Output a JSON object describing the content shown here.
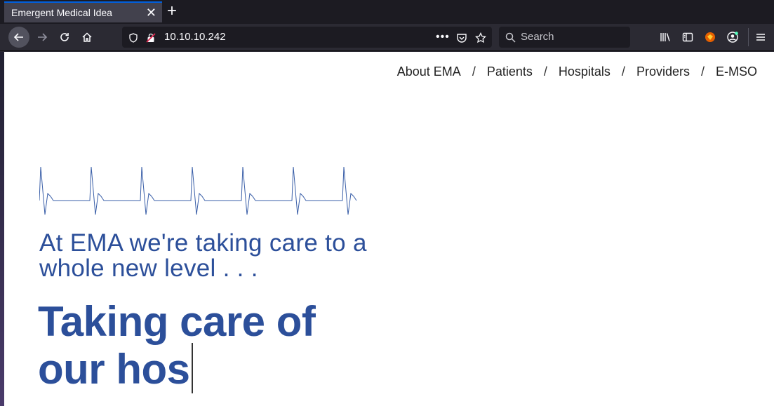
{
  "browser": {
    "tab_title": "Emergent Medical Idea",
    "tab_close": "✕",
    "new_tab": "+",
    "url": "10.10.10.242",
    "search_placeholder": "Search"
  },
  "nav": {
    "items": [
      {
        "label": "About EMA"
      },
      {
        "label": "Patients"
      },
      {
        "label": "Hospitals"
      },
      {
        "label": "Providers"
      },
      {
        "label": "E-MSO"
      }
    ],
    "separator": "/"
  },
  "hero": {
    "tagline": "At EMA we're taking care to a whole new level . . .",
    "headline_line1": "Taking care of",
    "headline_line2": "our hos"
  },
  "colors": {
    "brand": "#2c4f9a",
    "ekg": "#3a5fa8"
  }
}
